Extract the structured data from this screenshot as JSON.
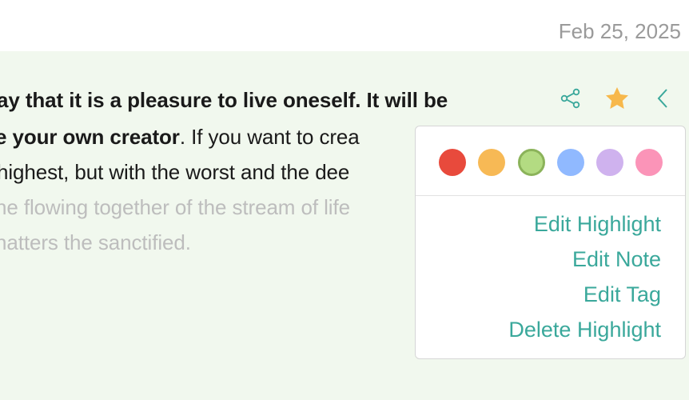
{
  "header": {
    "date": "Feb 25, 2025"
  },
  "highlight": {
    "line1_bold": "ay that it is a pleasure to live oneself. It will be",
    "line2_bold": "e your own creator",
    "line2_rest": ". If you want to crea",
    "line3": "highest, but with the worst and the dee",
    "line4": "he flowing together of the stream of life",
    "line5": "natters the sanctified."
  },
  "toolbar": {
    "share_icon": "share-icon",
    "star_icon": "star-icon",
    "back_icon": "chevron-left-icon",
    "star_color": "#f7b84b",
    "accent_color": "#3aa89b"
  },
  "popup": {
    "colors": [
      {
        "name": "red",
        "hex": "#e84a3c"
      },
      {
        "name": "orange",
        "hex": "#f7b955"
      },
      {
        "name": "green",
        "hex": "#b3db82",
        "selected": true
      },
      {
        "name": "blue",
        "hex": "#90b9ff"
      },
      {
        "name": "purple",
        "hex": "#cfb2ee"
      },
      {
        "name": "pink",
        "hex": "#fb94b8"
      }
    ],
    "menu": {
      "edit_highlight": "Edit Highlight",
      "edit_note": "Edit Note",
      "edit_tag": "Edit Tag",
      "delete_highlight": "Delete Highlight"
    }
  }
}
